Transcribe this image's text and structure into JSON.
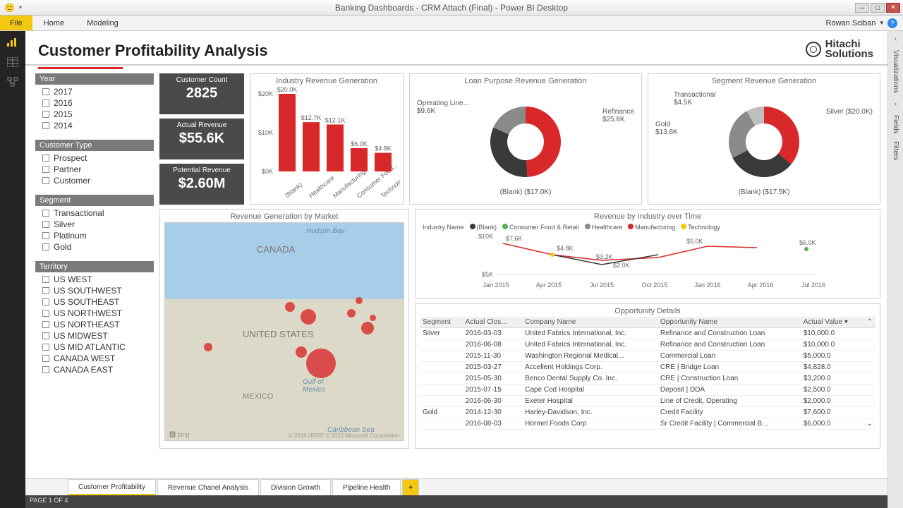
{
  "window": {
    "title": "Banking Dashboards - CRM Attach (Final)  - Power BI Desktop"
  },
  "ribbon": {
    "file": "File",
    "tabs": [
      "Home",
      "Modeling"
    ],
    "user": "Rowan Sciban"
  },
  "rightpanes": [
    "Visualizations",
    "Fields",
    "Filters"
  ],
  "page": {
    "title": "Customer Profitability Analysis",
    "brand_line1": "Hitachi",
    "brand_line2": "Solutions"
  },
  "filters": [
    {
      "name": "Year",
      "items": [
        "2017",
        "2016",
        "2015",
        "2014"
      ]
    },
    {
      "name": "Customer Type",
      "items": [
        "Prospect",
        "Partner",
        "Customer"
      ]
    },
    {
      "name": "Segment",
      "items": [
        "Transactional",
        "Silver",
        "Platinum",
        "Gold"
      ]
    },
    {
      "name": "Territory",
      "items": [
        "US WEST",
        "US SOUTHWEST",
        "US SOUTHEAST",
        "US NORTHWEST",
        "US NORTHEAST",
        "US MIDWEST",
        "US MID ATLANTIC",
        "CANADA WEST",
        "CANADA EAST"
      ]
    }
  ],
  "kpis": [
    {
      "label": "Customer Count",
      "value": "2825"
    },
    {
      "label": "Actual Revenue",
      "value": "$55.6K"
    },
    {
      "label": "Potential Revenue",
      "value": "$2.60M"
    }
  ],
  "chart_data": [
    {
      "id": "industry_bar",
      "type": "bar",
      "title": "Industry Revenue Generation",
      "categories": [
        "(Blank)",
        "Healthcare",
        "Manufacturing",
        "Consumer Food...",
        "Technology"
      ],
      "values": [
        20000,
        12700,
        12100,
        6000,
        4800
      ],
      "value_labels": [
        "$20.0K",
        "$12.7K",
        "$12.1K",
        "$6.0K",
        "$4.8K"
      ],
      "ylim": [
        0,
        20000
      ],
      "yticks": [
        "$0K",
        "$10K",
        "$20K"
      ],
      "color": "#d92829"
    },
    {
      "id": "loan_donut",
      "type": "pie",
      "title": "Loan Purpose Revenue Generation",
      "slices": [
        {
          "name": "Refinance",
          "label": "Refinance\n$25.8K",
          "value": 25800,
          "color": "#d92829"
        },
        {
          "name": "(Blank)",
          "label": "(Blank) ($17.0K)",
          "value": 17000,
          "color": "#3a3a3a"
        },
        {
          "name": "Operating Line",
          "label": "Operating Line...\n$9.6K",
          "value": 9600,
          "color": "#8a8a8a"
        }
      ]
    },
    {
      "id": "segment_donut",
      "type": "pie",
      "title": "Segment Revenue Generation",
      "slices": [
        {
          "name": "Silver",
          "label": "Silver ($20.0K)",
          "value": 20000,
          "color": "#d92829"
        },
        {
          "name": "(Blank)",
          "label": "(Blank) ($17.5K)",
          "value": 17500,
          "color": "#3a3a3a"
        },
        {
          "name": "Gold",
          "label": "Gold\n$13.6K",
          "value": 13600,
          "color": "#8a8a8a"
        },
        {
          "name": "Transactional",
          "label": "Transactional\n$4.5K",
          "value": 4500,
          "color": "#bfbfbf"
        }
      ]
    },
    {
      "id": "map",
      "type": "map",
      "title": "Revenue Generation by Market",
      "labels": {
        "canada": "CANADA",
        "usa": "UNITED STATES",
        "mexico": "MEXICO",
        "hudson": "Hudson Bay",
        "gulf": "Gulf of\nMexico",
        "caribbean": "Caribbean Sea"
      },
      "attrib": "© 2016 HERE   © 2016 Microsoft Corporation",
      "bing": "bing"
    },
    {
      "id": "line",
      "type": "line",
      "title": "Revenue by Industry over Time",
      "x": [
        "Jan 2015",
        "Apr 2015",
        "Jul 2015",
        "Oct 2015",
        "Jan 2016",
        "Apr 2016",
        "Jul 2016"
      ],
      "yticks": [
        "$5K",
        "$10K"
      ],
      "legend_title": "Industry Name",
      "series": [
        {
          "name": "(Blank)",
          "color": "#3a3a3a"
        },
        {
          "name": "Consumer Food & Retail",
          "color": "#5ab05a"
        },
        {
          "name": "Healthcare",
          "color": "#8a8a8a"
        },
        {
          "name": "Manufacturing",
          "color": "#d92829"
        },
        {
          "name": "Technology",
          "color": "#f2c811"
        }
      ],
      "annot": [
        "$7.6K",
        "$4.8K",
        "$3.2K",
        "$2.0K",
        "$5.0K",
        "$6.0K"
      ]
    }
  ],
  "table": {
    "title": "Opportunity Details",
    "columns": [
      "Segment",
      "Actual Clos...",
      "Company Name",
      "Opportunity Name",
      "Actual Value"
    ],
    "rows": [
      [
        "Silver",
        "2016-03-03",
        "United Fabrics International, Inc.",
        "Refinance and Construction Loan",
        "$10,000.0"
      ],
      [
        "",
        "2016-06-08",
        "United Fabrics International, Inc.",
        "Refinance and Construction Loan",
        "$10,000.0"
      ],
      [
        "",
        "2015-11-30",
        "Washington Regional Medical...",
        "Commercial Loan",
        "$5,000.0"
      ],
      [
        "",
        "2015-03-27",
        "Accellent Holdings Corp.",
        "CRE | Bridge Loan",
        "$4,828.0"
      ],
      [
        "",
        "2015-05-30",
        "Benco Dental Supply Co. Inc.",
        "CRE | Construction Loan",
        "$3,200.0"
      ],
      [
        "",
        "2015-07-15",
        "Cape Cod Hospital",
        "Deposit | DDA",
        "$2,500.0"
      ],
      [
        "",
        "2016-06-30",
        "Exeter Hospital",
        "Line of Credit, Operating",
        "$2,000.0"
      ],
      [
        "Gold",
        "2014-12-30",
        "Harley-Davidson, Inc.",
        "Credit Facility",
        "$7,600.0"
      ],
      [
        "",
        "2016-08-03",
        "Hormel Foods Corp",
        "Sr Credit Facility | Commercial B...",
        "$6,000.0"
      ]
    ]
  },
  "page_tabs": [
    "Customer Profitability",
    "Revenue Chanel Analysis",
    "Division Growth",
    "Pipeline Health"
  ],
  "status": "PAGE 1 OF 4"
}
